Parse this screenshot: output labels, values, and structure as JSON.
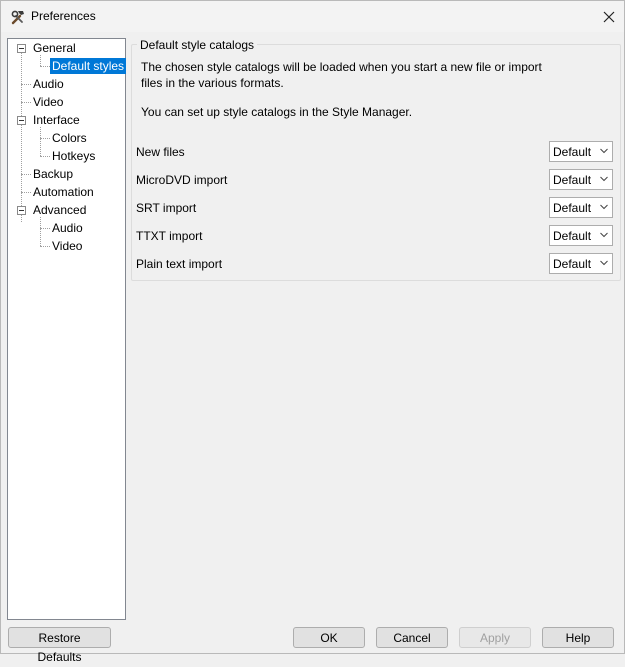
{
  "window": {
    "title": "Preferences",
    "icon": "tools-icon"
  },
  "tree": {
    "items": [
      {
        "label": "General",
        "expanded": true
      },
      {
        "label": "Default styles",
        "selected": true
      },
      {
        "label": "Audio"
      },
      {
        "label": "Video"
      },
      {
        "label": "Interface",
        "expanded": true
      },
      {
        "label": "Colors"
      },
      {
        "label": "Hotkeys"
      },
      {
        "label": "Backup"
      },
      {
        "label": "Automation"
      },
      {
        "label": "Advanced",
        "expanded": true
      },
      {
        "label": "Audio"
      },
      {
        "label": "Video"
      }
    ]
  },
  "panel": {
    "group_title": "Default style catalogs",
    "description_line1": "The chosen style catalogs will be loaded when you start a new file or import",
    "description_line2": "files in the various formats.",
    "description_line3": "You can set up style catalogs in the Style Manager.",
    "rows": [
      {
        "label": "New files",
        "value": "Default"
      },
      {
        "label": "MicroDVD import",
        "value": "Default"
      },
      {
        "label": "SRT import",
        "value": "Default"
      },
      {
        "label": "TTXT import",
        "value": "Default"
      },
      {
        "label": "Plain text import",
        "value": "Default"
      }
    ]
  },
  "footer": {
    "restore_defaults": "Restore Defaults",
    "ok": "OK",
    "cancel": "Cancel",
    "apply": "Apply",
    "apply_enabled": false,
    "help": "Help"
  },
  "colors": {
    "selection": "#0078d7",
    "background": "#f0f0f0"
  }
}
